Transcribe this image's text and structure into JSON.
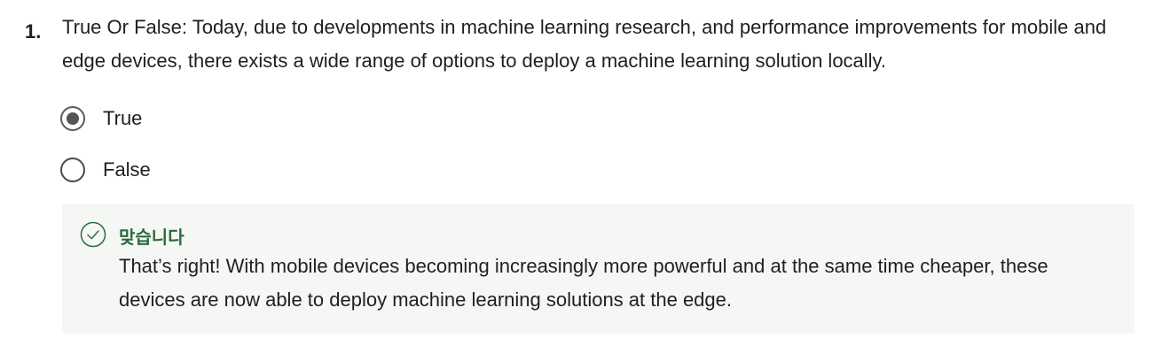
{
  "question": {
    "number": "1.",
    "text": "True Or False: Today, due to developments in machine learning research, and performance improvements for mobile and edge devices, there exists a wide range of options to deploy a machine learning solution locally.",
    "options": [
      {
        "label": "True",
        "selected": true
      },
      {
        "label": "False",
        "selected": false
      }
    ]
  },
  "feedback": {
    "status_icon": "check-circle-icon",
    "title": "맞습니다",
    "text": "That’s right! With mobile devices becoming increasingly more powerful and at the same time cheaper, these devices are now able to deploy machine learning solutions at the edge.",
    "accent_color": "#2d6a3e"
  }
}
